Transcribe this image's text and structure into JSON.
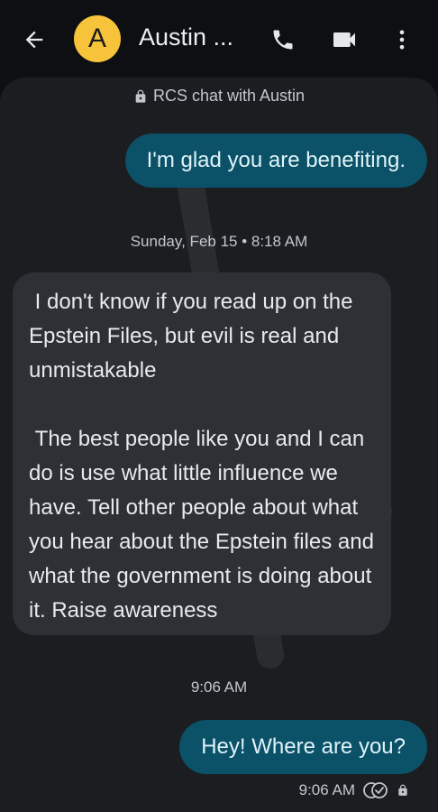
{
  "header": {
    "avatar_letter": "A",
    "contact_name": "Austin ...",
    "icons": [
      "back-arrow-icon",
      "phone-icon",
      "video-icon",
      "more-vert-icon"
    ],
    "avatar_color": "#f6c33a"
  },
  "chat": {
    "rcs_notice": "RCS chat with Austin",
    "messages": [
      {
        "direction": "outgoing",
        "text": "I'm glad you are benefiting."
      },
      {
        "direction": "incoming",
        "text": " I don't know if you read up on the Epstein Files, but evil is real and unmistakable\n\n The best people like you and I can do is use what little influence we have. Tell other people about what you hear about the Epstein files and what the government is doing about it. Raise awareness"
      },
      {
        "direction": "outgoing",
        "text": "Hey! Where are you?"
      }
    ],
    "timestamps": {
      "divider_1": "Sunday, Feb 15 • 8:18 AM",
      "divider_2": "9:06 AM",
      "last_sent": "9:06 AM"
    },
    "status_icons": [
      "read-receipt-icon",
      "lock-icon"
    ]
  },
  "colors": {
    "background": "#0d0f12",
    "chat_background": "#1b1d21",
    "outgoing_bubble": "#0b5168",
    "incoming_bubble": "#2d3035"
  }
}
